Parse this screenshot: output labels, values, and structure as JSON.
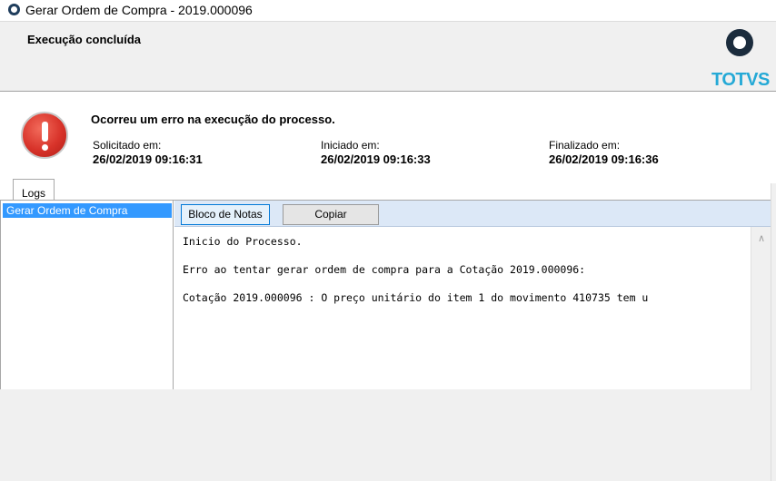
{
  "window": {
    "title": "Gerar Ordem de Compra - 2019.000096"
  },
  "header": {
    "title": "Execução concluída",
    "logo_text": "TOTVS"
  },
  "status": {
    "message": "Ocorreu um erro na execução do processo.",
    "requested_label": "Solicitado em:",
    "requested_value": "26/02/2019 09:16:31",
    "started_label": "Iniciado em:",
    "started_value": "26/02/2019 09:16:33",
    "finished_label": "Finalizado em:",
    "finished_value": "26/02/2019 09:16:36"
  },
  "tabs": [
    {
      "label": "Logs"
    }
  ],
  "log_list": [
    {
      "label": "Gerar Ordem de Compra"
    }
  ],
  "toolbar": {
    "notepad_label": "Bloco de Notas",
    "copy_label": "Copiar"
  },
  "log_lines": [
    "Inicio do Processo.",
    "Erro ao tentar gerar ordem de compra para a Cotação 2019.000096:",
    "Cotação 2019.000096 : O preço unitário do item 1 do movimento 410735 tem u"
  ],
  "colors": {
    "selection": "#3399ff",
    "toolbar_bg": "#dce8f7",
    "logo_blue": "#25a9d6",
    "error_red": "#d8332a"
  }
}
